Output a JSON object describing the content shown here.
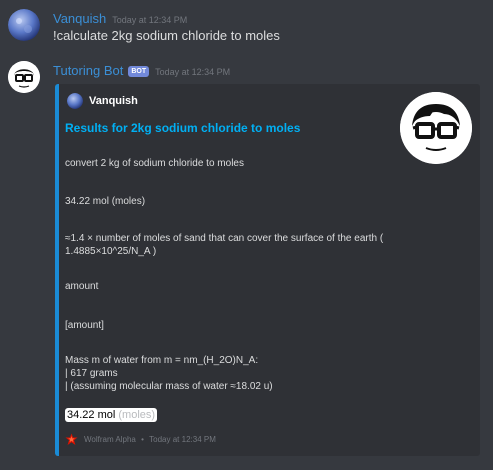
{
  "messages": [
    {
      "author": "Vanquish",
      "timestamp": "Today at 12:34 PM",
      "content": "!calculate 2kg sodium chloride to moles",
      "name_color": "#3b8fd6",
      "avatar_icon": "blue-planet-avatar"
    },
    {
      "author": "Tutoring Bot",
      "bot_tag": "BOT",
      "timestamp": "Today at 12:34 PM",
      "name_color": "#3b8fd6",
      "avatar_icon": "nerd-glasses-avatar"
    }
  ],
  "embed": {
    "border_color": "#1a8bd6",
    "author": "Vanquish",
    "title": "Results for 2kg sodium chloride to moles",
    "lines": [
      "convert 2 kg of sodium chloride to moles",
      "34.22 mol (moles)",
      "≈1.4 × number of moles of sand that can cover the surface of the earth (",
      "1.4885×10^25/N_A )",
      "amount",
      "[amount]",
      "Mass m of water from m = nm_(H_2O)N_A:",
      "| 617 grams",
      "| (assuming molecular mass of water ≈18.02 u)"
    ],
    "final_value": "34.22 mol",
    "final_unit": "(moles)",
    "footer_text": "Wolfram Alpha",
    "footer_separator": "•",
    "footer_timestamp": "Today at 12:34 PM",
    "footer_icon": "wolfram-alpha-icon",
    "thumbnail_icon": "nerd-glasses-thumbnail"
  }
}
